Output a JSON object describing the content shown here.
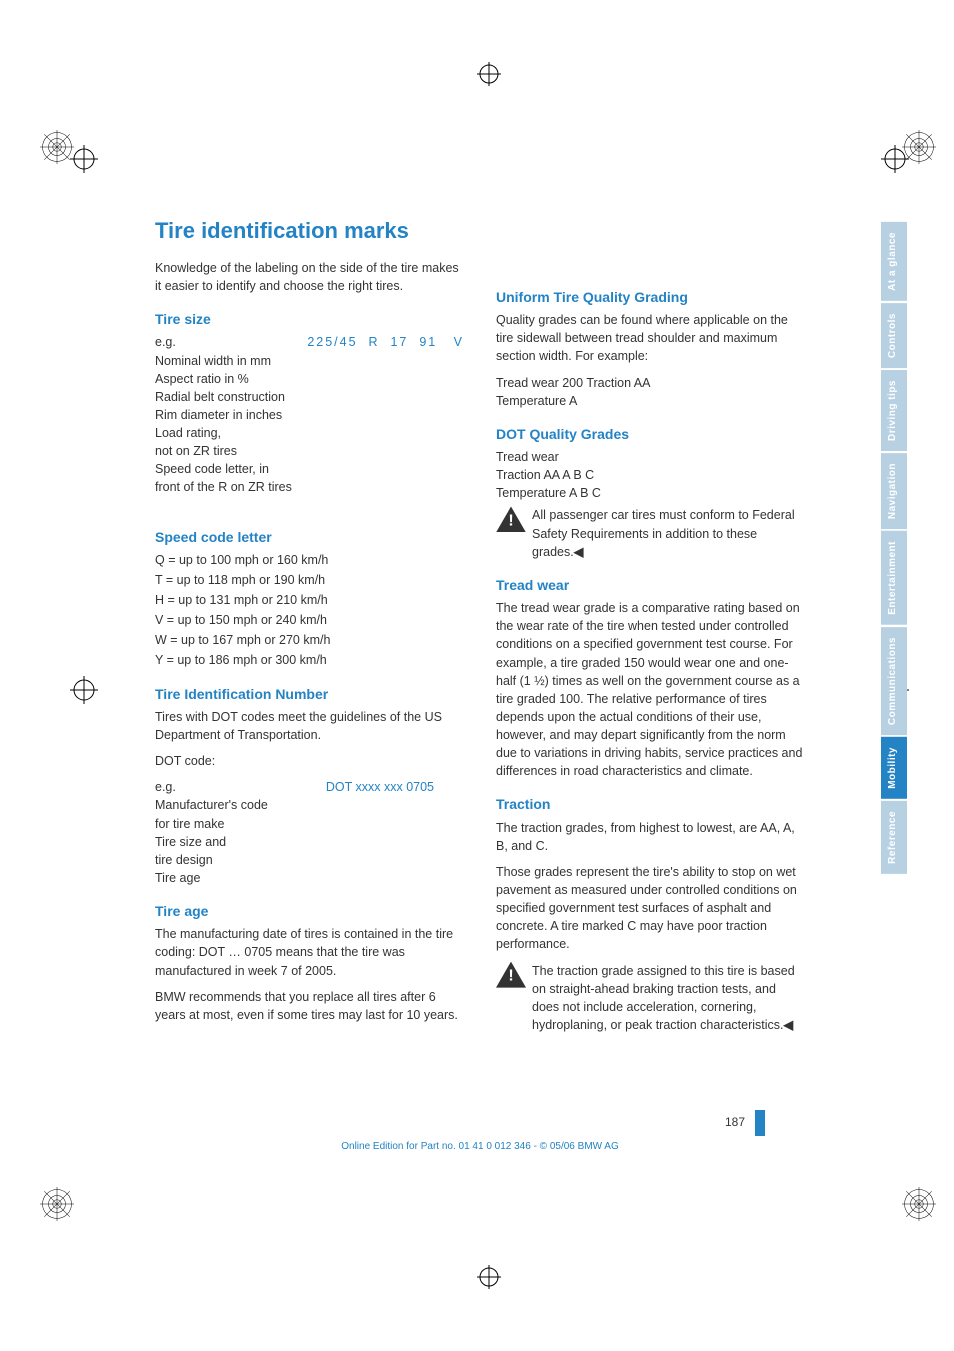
{
  "title": "Tire identification marks",
  "intro": "Knowledge of the labeling on the side of the tire makes it easier to identify and choose the right tires.",
  "tire_size": {
    "heading": "Tire size",
    "eg": "e.g.",
    "value": "225/45  R  17  91   V",
    "rows": [
      "Nominal width in mm",
      "Aspect ratio in %",
      "Radial belt construction",
      "Rim diameter in inches",
      "Load rating,",
      "not on ZR tires",
      "Speed code letter, in",
      "front of the R on ZR tires"
    ]
  },
  "speed_code": {
    "heading": "Speed code letter",
    "items": [
      "Q = up to 100 mph or 160 km/h",
      "T = up to 118 mph or 190 km/h",
      "H = up to 131 mph or 210 km/h",
      "V = up to 150 mph or 240 km/h",
      "W = up to 167 mph or 270 km/h",
      "Y = up to 186 mph or 300 km/h"
    ]
  },
  "tin": {
    "heading": "Tire Identification Number",
    "p1": "Tires with DOT codes meet the guidelines of the US Department of Transportation.",
    "p2": "DOT code:",
    "eg": "e.g.",
    "value": "DOT xxxx xxx 0705",
    "rows": [
      "Manufacturer's code",
      "for tire make",
      "Tire size and",
      "tire design",
      "Tire age"
    ]
  },
  "tire_age": {
    "heading": "Tire age",
    "p1": "The manufacturing date of tires is contained in the tire coding: DOT … 0705 means that the tire was manufactured in week 7 of 2005.",
    "p2": "BMW recommends that you replace all tires after 6 years at most, even if some tires may last for 10 years."
  },
  "utqg": {
    "heading": "Uniform Tire Quality Grading",
    "p1": "Quality grades can be found where applicable on the tire sidewall between tread shoulder and maximum section width. For example:",
    "p2": "Tread wear 200 Traction AA",
    "p3": "Temperature A"
  },
  "dot_grades": {
    "heading": "DOT Quality Grades",
    "l1": "Tread wear",
    "l2": "Traction AA A B C",
    "l3": "Temperature A B C",
    "warn": "All passenger car tires must conform to Federal Safety Requirements in addition to these grades."
  },
  "tread_wear": {
    "heading": "Tread wear",
    "p": "The tread wear grade is a comparative rating based on the wear rate of the tire when tested under controlled conditions on a specified government test course. For example, a tire graded 150 would wear one and one-half (1 ½) times as well on the government course as a tire graded 100. The relative performance of tires depends upon the actual conditions of their use, however, and may depart significantly from the norm due to variations in driving habits, service practices and differences in road characteristics and climate."
  },
  "traction": {
    "heading": "Traction",
    "p1": "The traction grades, from highest to lowest, are AA, A, B, and C.",
    "p2": "Those grades represent the tire's ability to stop on wet pavement as measured under controlled conditions on specified government test surfaces of asphalt and concrete. A tire marked C may have poor traction performance.",
    "warn": "The traction grade assigned to this tire is based on straight-ahead braking traction tests, and does not include acceleration, cornering, hydroplaning, or peak traction characteristics."
  },
  "tabs": [
    "At a glance",
    "Controls",
    "Driving tips",
    "Navigation",
    "Entertainment",
    "Communications",
    "Mobility",
    "Reference"
  ],
  "footer": {
    "page": "187",
    "line": "Online Edition for Part no. 01 41 0 012 346 - © 05/06 BMW AG"
  },
  "end_arrow": "◀"
}
